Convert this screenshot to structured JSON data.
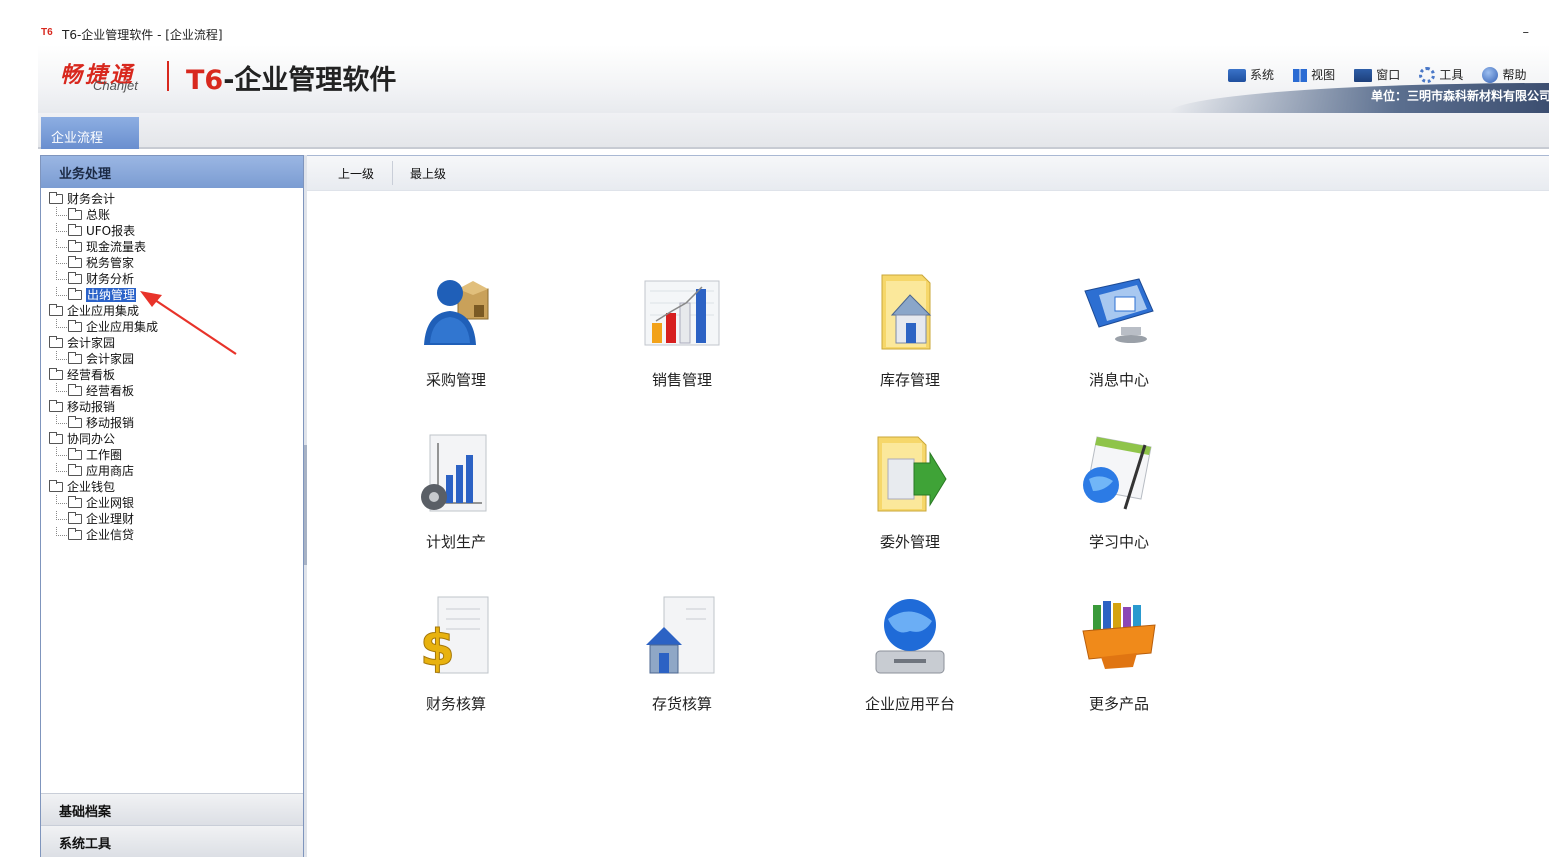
{
  "window": {
    "app_icon": "T6",
    "title": "T6-企业管理软件 - [企业流程]",
    "minimize": "–"
  },
  "header": {
    "logo_chinese": "畅捷通",
    "logo_english": "Chanjet",
    "product_prefix": "T6",
    "product_name": "-企业管理软件",
    "menu": [
      {
        "label": "系统",
        "icon": "system-icon"
      },
      {
        "label": "视图",
        "icon": "view-icon"
      },
      {
        "label": "窗口",
        "icon": "window-icon"
      },
      {
        "label": "工具",
        "icon": "tools-icon"
      },
      {
        "label": "帮助",
        "icon": "help-icon"
      }
    ],
    "unit": "单位：三明市森科新材料有限公司"
  },
  "tabs": [
    {
      "label": "企业流程",
      "active": true
    }
  ],
  "sidebar": {
    "title": "业务处理",
    "tree": [
      {
        "label": "财务会计",
        "level": 0
      },
      {
        "label": "总账",
        "level": 1
      },
      {
        "label": "UFO报表",
        "level": 1
      },
      {
        "label": "现金流量表",
        "level": 1
      },
      {
        "label": "税务管家",
        "level": 1
      },
      {
        "label": "财务分析",
        "level": 1
      },
      {
        "label": "出纳管理",
        "level": 1,
        "selected": true
      },
      {
        "label": "企业应用集成",
        "level": 0
      },
      {
        "label": "企业应用集成",
        "level": 1
      },
      {
        "label": "会计家园",
        "level": 0
      },
      {
        "label": "会计家园",
        "level": 1
      },
      {
        "label": "经营看板",
        "level": 0
      },
      {
        "label": "经营看板",
        "level": 1
      },
      {
        "label": "移动报销",
        "level": 0
      },
      {
        "label": "移动报销",
        "level": 1
      },
      {
        "label": "协同办公",
        "level": 0
      },
      {
        "label": "工作圈",
        "level": 1
      },
      {
        "label": "应用商店",
        "level": 1
      },
      {
        "label": "企业钱包",
        "level": 0
      },
      {
        "label": "企业网银",
        "level": 1
      },
      {
        "label": "企业理财",
        "level": 1
      },
      {
        "label": "企业信贷",
        "level": 1
      }
    ],
    "footer": [
      "基础档案",
      "系统工具"
    ]
  },
  "toolbar": {
    "up_label": "上一级",
    "top_label": "最上级"
  },
  "modules": [
    {
      "label": "采购管理",
      "icon": "purchase-icon"
    },
    {
      "label": "销售管理",
      "icon": "sales-chart-icon"
    },
    {
      "label": "库存管理",
      "icon": "inventory-folder-icon"
    },
    {
      "label": "消息中心",
      "icon": "message-monitor-icon"
    },
    {
      "label": "计划生产",
      "icon": "production-plan-icon"
    },
    {
      "label": "委外管理",
      "icon": "outsourcing-folder-icon"
    },
    {
      "label": "学习中心",
      "icon": "learning-globe-icon"
    },
    {
      "label": "财务核算",
      "icon": "dollar-document-icon"
    },
    {
      "label": "存货核算",
      "icon": "house-document-icon"
    },
    {
      "label": "企业应用平台",
      "icon": "platform-globe-icon"
    },
    {
      "label": "更多产品",
      "icon": "books-box-icon"
    }
  ],
  "colors": {
    "accent": "#7b9cd2",
    "brand_red": "#d8281e",
    "selected": "#2a62c9",
    "annotation_arrow": "#e8332a"
  }
}
